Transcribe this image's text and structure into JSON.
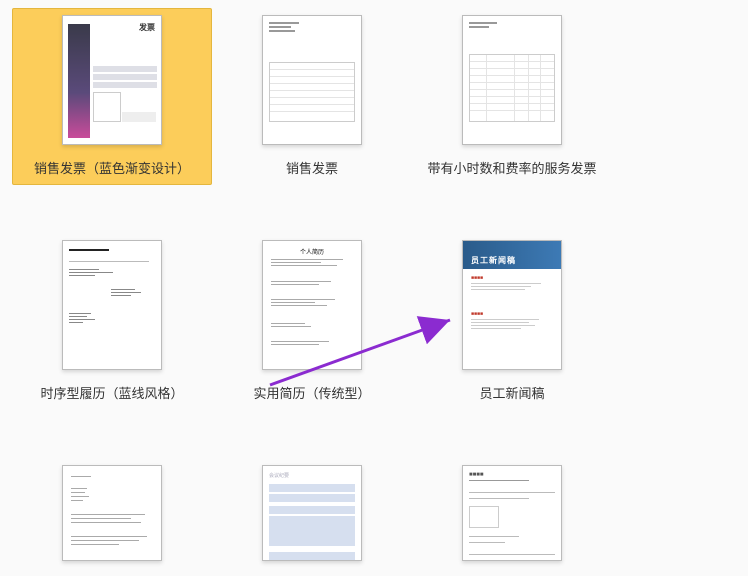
{
  "templates": [
    {
      "id": "sales-invoice-blue-gradient",
      "label": "销售发票（蓝色渐变设计）",
      "selected": true,
      "thumb_title": "发票"
    },
    {
      "id": "sales-invoice",
      "label": "销售发票",
      "selected": false
    },
    {
      "id": "service-invoice-hours-rates",
      "label": "带有小时数和费率的服务发票",
      "selected": false
    },
    {
      "id": "chronological-resume-blueline",
      "label": "时序型履历（蓝线风格）",
      "selected": false
    },
    {
      "id": "practical-resume-traditional",
      "label": "实用简历（传统型）",
      "selected": false,
      "thumb_title": "个人简历"
    },
    {
      "id": "employee-newsletter",
      "label": "员工新闻稿",
      "selected": false,
      "thumb_title": "员工新闻稿"
    },
    {
      "id": "memo",
      "label": "",
      "selected": false
    },
    {
      "id": "meeting-minutes",
      "label": "",
      "selected": false,
      "thumb_title": "会议纪要"
    },
    {
      "id": "report",
      "label": "",
      "selected": false
    }
  ],
  "annotation": {
    "arrow_color": "#8b2bd0"
  }
}
